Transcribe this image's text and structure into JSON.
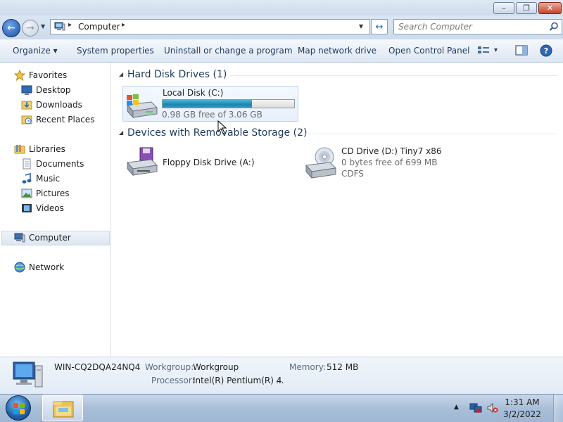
{
  "window": {
    "controls": {
      "minimize": "–",
      "maximize": "❐",
      "close": "✕"
    }
  },
  "address": {
    "root_glyph": "▸",
    "path": "Computer",
    "path_arrow": "▸",
    "dropdown": "▾",
    "refresh_glyph": "↔"
  },
  "search": {
    "placeholder": "Search Computer"
  },
  "toolbar": {
    "organize": "Organize ▾",
    "system_properties": "System properties",
    "uninstall": "Uninstall or change a program",
    "map_drive": "Map network drive",
    "control_panel": "Open Control Panel",
    "views_dropdown": "▾"
  },
  "nav": {
    "favorites": "Favorites",
    "desktop": "Desktop",
    "downloads": "Downloads",
    "recent_places": "Recent Places",
    "libraries": "Libraries",
    "documents": "Documents",
    "music": "Music",
    "pictures": "Pictures",
    "videos": "Videos",
    "computer": "Computer",
    "network": "Network"
  },
  "groups": {
    "hdd": "Hard Disk Drives (1)",
    "removable": "Devices with Removable Storage (2)"
  },
  "drives": {
    "c": {
      "name": "Local Disk (C:)",
      "free": "0.98 GB free of 3.06 GB",
      "used_fraction": 0.68
    },
    "a": {
      "name": "Floppy Disk Drive (A:)"
    },
    "d": {
      "name": "CD Drive (D:) Tiny7 x86",
      "free": "0 bytes free of 699 MB",
      "fs": "CDFS"
    }
  },
  "details": {
    "computer_name": "WIN-CQ2DQA24NQ4",
    "workgroup_label": "Workgroup:",
    "workgroup_value": "Workgroup",
    "memory_label": "Memory:",
    "memory_value": "512 MB",
    "processor_label": "Processor:",
    "processor_value": "Intel(R) Pentium(R) 4",
    "processor_ellipsis": "..."
  },
  "taskbar": {
    "tray_arrow": "▲",
    "time": "1:31 AM",
    "date": "3/2/2022"
  },
  "colors": {
    "capacity_fill": "#1d84ad",
    "accent": "#1e395b"
  }
}
